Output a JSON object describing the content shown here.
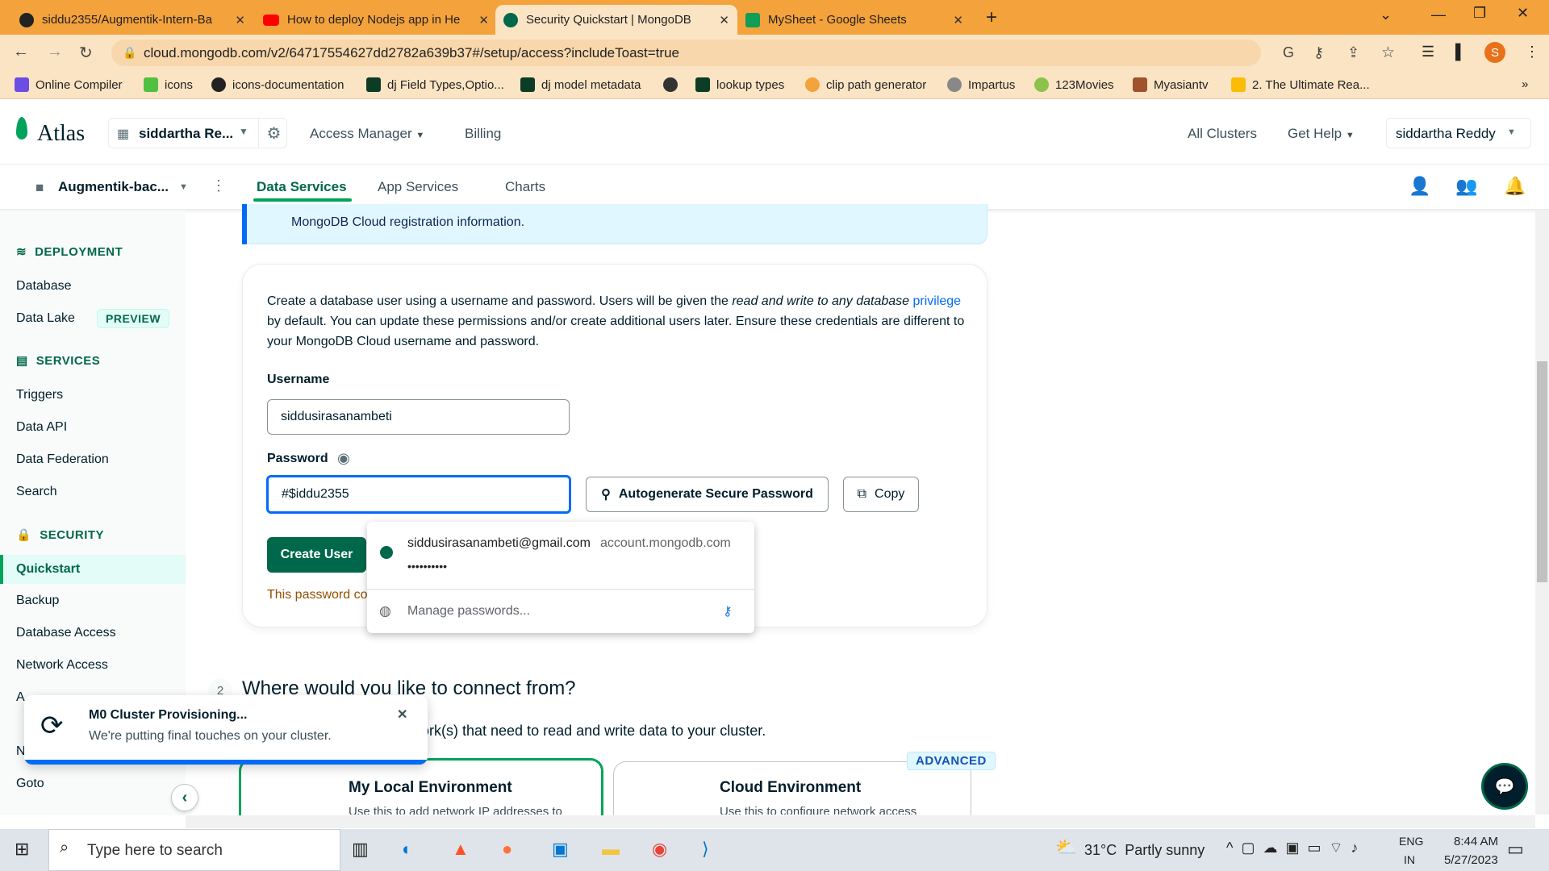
{
  "browser": {
    "tabs": [
      {
        "title": "siddu2355/Augmentik-Intern-Ba",
        "icon": "github-icon"
      },
      {
        "title": "How to deploy Nodejs app in He",
        "icon": "youtube-icon"
      },
      {
        "title": "Security Quickstart | MongoDB",
        "icon": "mongodb-leaf-icon"
      },
      {
        "title": "MySheet - Google Sheets",
        "icon": "sheets-icon"
      }
    ],
    "url": "cloud.mongodb.com/v2/64717554627dd2782a639b37#/setup/access?includeToast=true",
    "profile_initial": "S",
    "bookmarks": [
      "Online Compiler",
      "icons",
      "icons-documentation",
      "dj Field Types,Optio...",
      "dj model metadata",
      "",
      "lookup types",
      "clip path generator",
      "Impartus",
      "123Movies",
      "Myasiantv",
      "2. The Ultimate Rea..."
    ]
  },
  "atlas": {
    "logo": "Atlas",
    "org": "siddartha Re...",
    "access_manager": "Access Manager",
    "billing": "Billing",
    "all_clusters": "All Clusters",
    "get_help": "Get Help",
    "user": "siddartha Reddy",
    "project": "Augmentik-bac...",
    "tabs": [
      "Data Services",
      "App Services",
      "Charts"
    ]
  },
  "sidebar": {
    "deployment": "DEPLOYMENT",
    "database": "Database",
    "data_lake": "Data Lake",
    "preview": "PREVIEW",
    "services": "SERVICES",
    "triggers": "Triggers",
    "data_api": "Data API",
    "data_federation": "Data Federation",
    "search": "Search",
    "security": "SECURITY",
    "quickstart": "Quickstart",
    "backup": "Backup",
    "database_access": "Database Access",
    "network_access": "Network Access",
    "advanced_partial": "A",
    "n_partial": "N",
    "goto": "Goto"
  },
  "main": {
    "banner_text": "MongoDB Cloud registration information.",
    "desc_1": "Create a database user using a username and password. Users will be given the",
    "desc_italic": "read and write to any database",
    "desc_link": "privilege",
    "desc_2": "by default. You can update these permissions and/or create additional users later. Ensure these",
    "desc_3": "credentials are different to your MongoDB Cloud username and password.",
    "username_label": "Username",
    "username_value": "siddusirasanambeti",
    "password_label": "Password",
    "password_value": "#$iddu2355",
    "autogen": "Autogenerate Secure Password",
    "copy": "Copy",
    "create_user": "Create User",
    "password_warning": "This password co",
    "section2_num": "2",
    "section2_title": "Where would you like to connect from?",
    "section2_sub": "ork(s) that need to read and write data to your cluster.",
    "advanced": "ADVANCED",
    "local_env": "My Local Environment",
    "local_desc": "Use this to add network IP addresses to",
    "cloud_env": "Cloud Environment",
    "cloud_desc": "Use this to configure network access"
  },
  "autofill": {
    "email": "siddusirasanambeti@gmail.com",
    "domain": "account.mongodb.com",
    "masked": "••••••••••",
    "manage": "Manage passwords..."
  },
  "toast": {
    "title": "M0 Cluster Provisioning...",
    "body": "We're putting final touches on your cluster."
  },
  "taskbar": {
    "search": "Type here to search",
    "weather": "31°C  Partly sunny",
    "lang1": "ENG",
    "lang2": "IN",
    "time": "8:44 AM",
    "date": "5/27/2023"
  }
}
